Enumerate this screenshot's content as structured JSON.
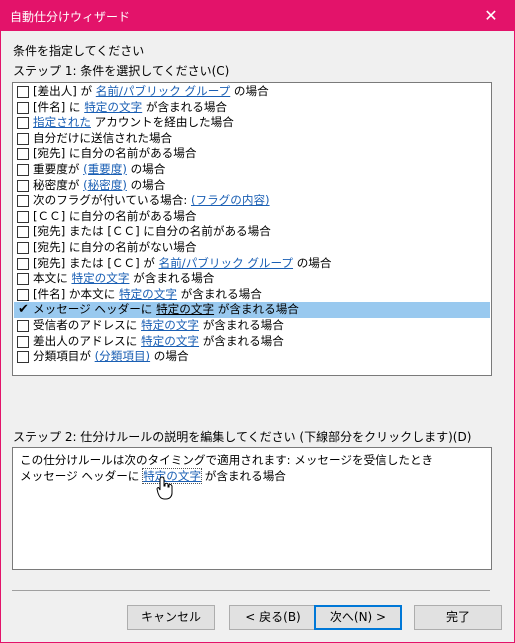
{
  "window": {
    "title": "自動仕分けウィザード",
    "close_glyph": "✕"
  },
  "header": {
    "label": "条件を指定してください",
    "step1": "ステップ 1: 条件を選択してください(C)"
  },
  "conditions": [
    {
      "parts": [
        {
          "t": "[差出人] が "
        },
        {
          "l": "名前/パブリック グループ"
        },
        {
          "t": " の場合"
        }
      ],
      "checked": false
    },
    {
      "parts": [
        {
          "t": "[件名] に "
        },
        {
          "l": "特定の文字"
        },
        {
          "t": " が含まれる場合"
        }
      ],
      "checked": false
    },
    {
      "parts": [
        {
          "l": "指定された"
        },
        {
          "t": " アカウントを経由した場合"
        }
      ],
      "checked": false
    },
    {
      "parts": [
        {
          "t": "自分だけに送信された場合"
        }
      ],
      "checked": false
    },
    {
      "parts": [
        {
          "t": "[宛先] に自分の名前がある場合"
        }
      ],
      "checked": false
    },
    {
      "parts": [
        {
          "t": "重要度が "
        },
        {
          "l": "(重要度)"
        },
        {
          "t": " の場合"
        }
      ],
      "checked": false
    },
    {
      "parts": [
        {
          "t": "秘密度が "
        },
        {
          "l": "(秘密度)"
        },
        {
          "t": " の場合"
        }
      ],
      "checked": false
    },
    {
      "parts": [
        {
          "t": "次のフラグが付いている場合: "
        },
        {
          "l": "(フラグの内容)"
        }
      ],
      "checked": false
    },
    {
      "parts": [
        {
          "t": "[ＣＣ] に自分の名前がある場合"
        }
      ],
      "checked": false
    },
    {
      "parts": [
        {
          "t": "[宛先] または [ＣＣ] に自分の名前がある場合"
        }
      ],
      "checked": false
    },
    {
      "parts": [
        {
          "t": "[宛先] に自分の名前がない場合"
        }
      ],
      "checked": false
    },
    {
      "parts": [
        {
          "t": "[宛先] または [ＣＣ] が "
        },
        {
          "l": "名前/パブリック グループ"
        },
        {
          "t": " の場合"
        }
      ],
      "checked": false
    },
    {
      "parts": [
        {
          "t": "本文に "
        },
        {
          "l": "特定の文字"
        },
        {
          "t": " が含まれる場合"
        }
      ],
      "checked": false
    },
    {
      "parts": [
        {
          "t": "[件名] か本文に "
        },
        {
          "l": "特定の文字"
        },
        {
          "t": " が含まれる場合"
        }
      ],
      "checked": false
    },
    {
      "parts": [
        {
          "t": "メッセージ ヘッダーに "
        },
        {
          "l": "特定の文字"
        },
        {
          "t": " が含まれる場合"
        }
      ],
      "checked": true,
      "selected": true
    },
    {
      "parts": [
        {
          "t": "受信者のアドレスに "
        },
        {
          "l": "特定の文字"
        },
        {
          "t": " が含まれる場合"
        }
      ],
      "checked": false
    },
    {
      "parts": [
        {
          "t": "差出人のアドレスに "
        },
        {
          "l": "特定の文字"
        },
        {
          "t": " が含まれる場合"
        }
      ],
      "checked": false
    },
    {
      "parts": [
        {
          "t": "分類項目が "
        },
        {
          "l": "(分類項目)"
        },
        {
          "t": " の場合"
        }
      ],
      "checked": false
    }
  ],
  "check_glyph": "✔",
  "step2": {
    "label": "ステップ 2: 仕分けルールの説明を編集してください (下線部分をクリックします)(D)",
    "line1": "この仕分けルールは次のタイミングで適用されます: メッセージを受信したとき",
    "line2_before": "メッセージ ヘッダーに ",
    "line2_link": "特定の文字",
    "line2_after": " が含まれる場合"
  },
  "buttons": {
    "cancel": "キャンセル",
    "back": "< 戻る(B)",
    "next": "次へ(N) >",
    "finish": "完了"
  },
  "colors": {
    "titlebar": "#e3136a",
    "link": "#1a5fb4",
    "selection": "#99c9ef",
    "default_button_border": "#0078d7"
  }
}
